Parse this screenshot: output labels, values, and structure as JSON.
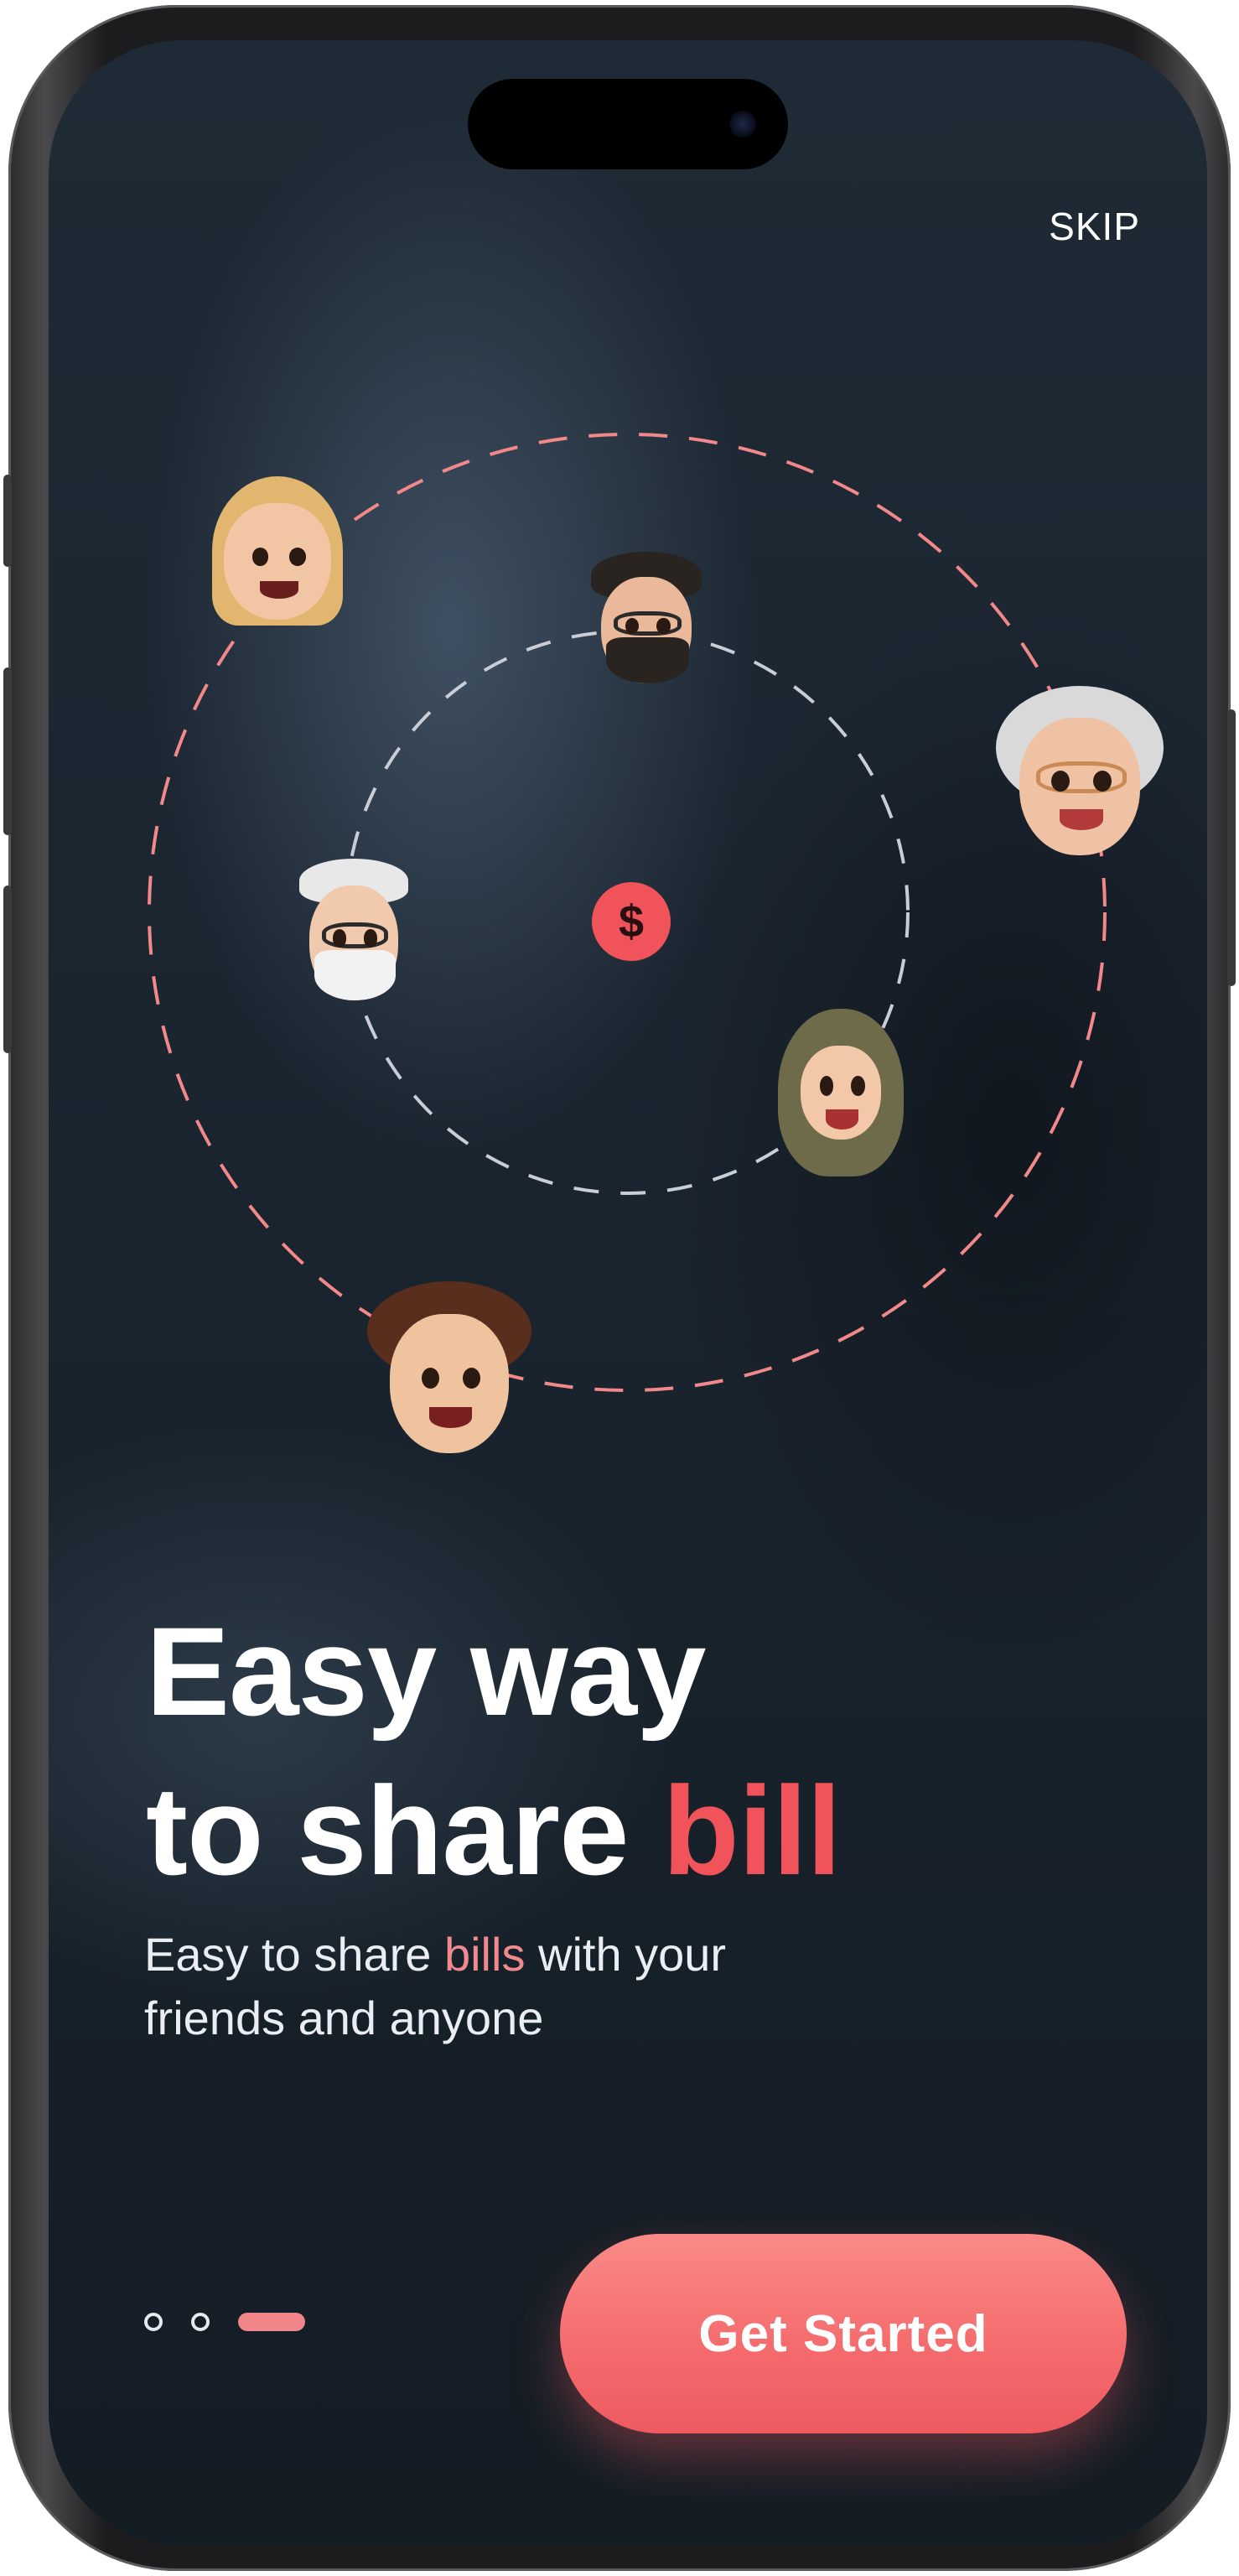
{
  "header": {
    "skip_label": "SKIP"
  },
  "center_icon": {
    "symbol": "$",
    "color": "#f0545a"
  },
  "headline": {
    "line1": "Easy way",
    "line2_plain": "to share ",
    "line2_accent": "bill"
  },
  "subtitle": {
    "part1": "Easy to share ",
    "accent": "bills",
    "part2": " with your",
    "line2": "friends and anyone"
  },
  "pager": {
    "total": 3,
    "active_index": 2
  },
  "cta": {
    "label": "Get Started"
  },
  "avatars": [
    {
      "name": "blonde-woman",
      "icon": "memoji-blonde-woman"
    },
    {
      "name": "bearded-man-glasses",
      "icon": "memoji-bearded-man"
    },
    {
      "name": "grandma-glasses",
      "icon": "memoji-grandma"
    },
    {
      "name": "grandpa-glasses",
      "icon": "memoji-grandpa"
    },
    {
      "name": "hijab-woman",
      "icon": "memoji-hijab-woman"
    },
    {
      "name": "curly-boy",
      "icon": "memoji-curly-boy"
    }
  ],
  "colors": {
    "accent": "#f0545a",
    "accent_soft": "#f08a8e",
    "background": "#1b2530"
  }
}
